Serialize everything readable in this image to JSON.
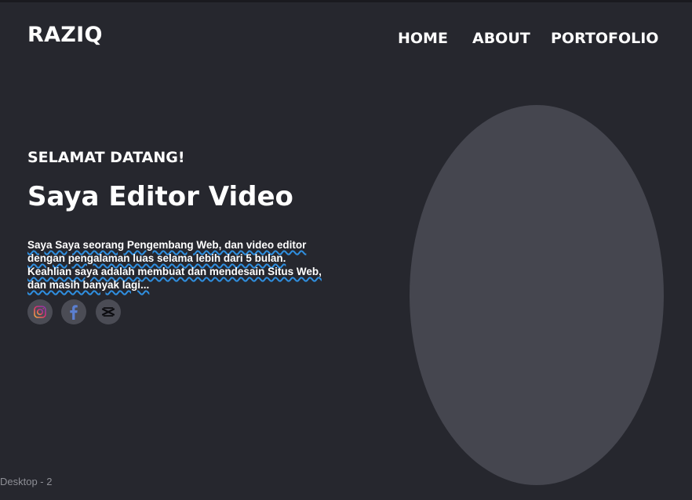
{
  "header": {
    "logo": "RAZIQ",
    "nav": [
      "HOME",
      "ABOUT",
      "PORTOFOLIO"
    ]
  },
  "hero": {
    "greeting": "SELAMAT DATANG!",
    "headline": "Saya Editor Video",
    "description_lines": [
      "Saya Saya seorang Pengembang Web, dan video editor",
      "dengan pengalaman luas selama lebih dari 5 bulan.",
      " Keahlian saya adalah membuat dan mendesain Situs Web,",
      "dan masih banyak lagi..."
    ],
    "socials": [
      {
        "icon": "instagram-icon"
      },
      {
        "icon": "facebook-icon"
      },
      {
        "icon": "capcut-icon"
      }
    ]
  },
  "canvas": {
    "frame_label": "Desktop - 2"
  },
  "colors": {
    "background": "#26272e",
    "portrait": "#45464f",
    "social_bg": "#4b4c55",
    "spell_underline": "#2f8fe0"
  }
}
